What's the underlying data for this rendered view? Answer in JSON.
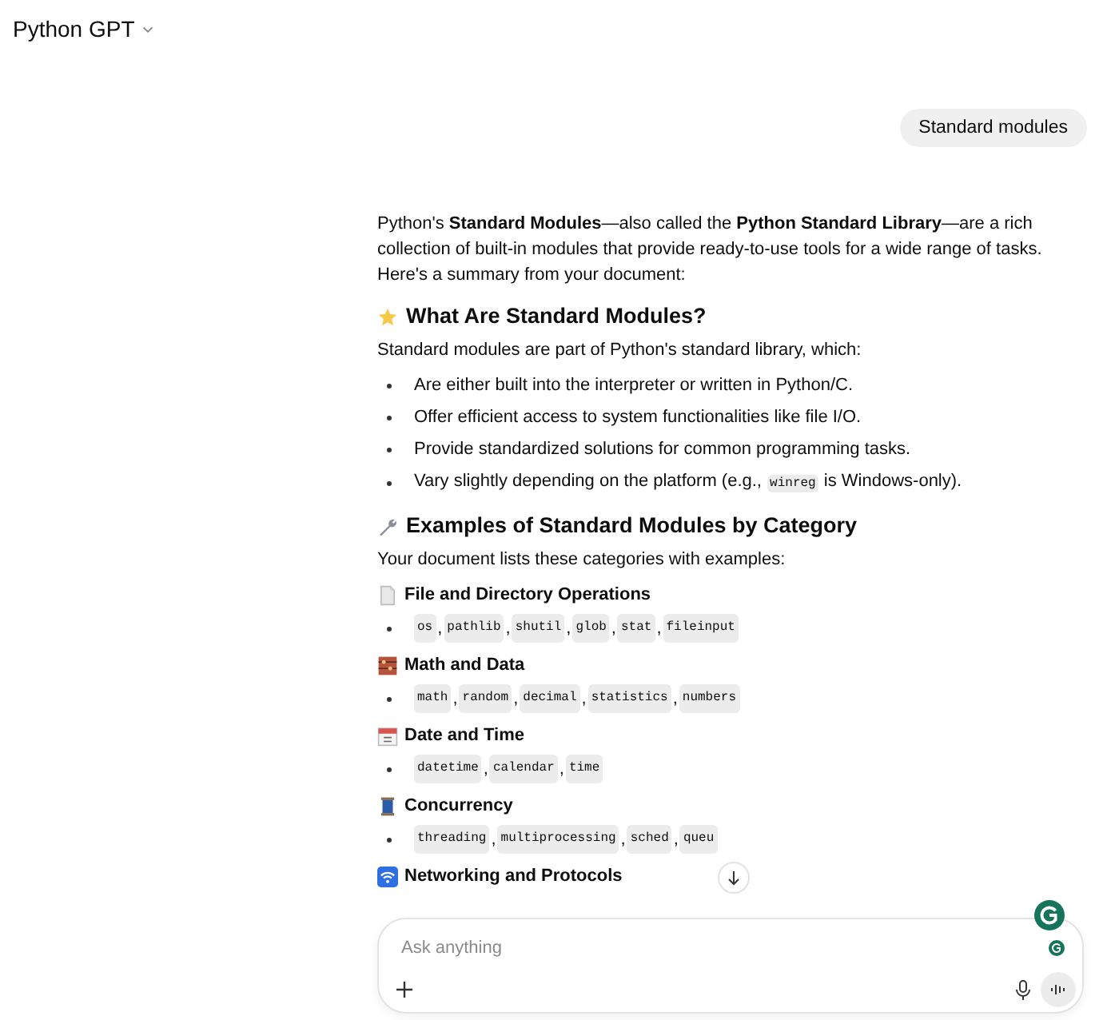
{
  "header": {
    "title": "Python GPT"
  },
  "user_message": "Standard modules",
  "response": [
    {
      "kind": "paragraph",
      "text": "Python's **Standard Modules**—also called the **Python Standard Library**—are a rich collection of built-in modules that provide ready-to-use tools for a wide range of tasks. Here's a summary from your document:"
    },
    {
      "kind": "heading",
      "text": "What Are Standard Modules?"
    },
    {
      "kind": "paragraph",
      "text": "Standard modules are part of Python's standard library, which:"
    },
    {
      "kind": "bullets",
      "items": [
        [
          {
            "text": "Are either built into the interpreter or written in Python/C."
          }
        ],
        [
          {
            "text": "Offer efficient access to system functionalities like file I/O."
          }
        ],
        [
          {
            "text": "Provide standardized solutions for common programming tasks."
          }
        ],
        [
          {
            "text": "Vary slightly depending on the platform (e.g., "
          },
          {
            "code": "winreg"
          },
          {
            "text": " is Windows-only)."
          }
        ]
      ]
    },
    {
      "kind": "heading",
      "text": "Examples of Standard Modules by Category"
    },
    {
      "kind": "paragraph",
      "text": "Your document lists these categories with examples:"
    },
    {
      "kind": "subheading",
      "text": "File and Directory Operations"
    },
    {
      "kind": "codes",
      "separator": ",",
      "items": [
        "os",
        "pathlib",
        "shutil",
        "glob",
        "stat",
        "fileinput"
      ]
    },
    {
      "kind": "subheading",
      "text": "Math and Data"
    },
    {
      "kind": "codes",
      "separator": ",",
      "items": [
        "math",
        "random",
        "decimal",
        "statistics",
        "numbers"
      ]
    },
    {
      "kind": "subheading",
      "text": "Date and Time"
    },
    {
      "kind": "codes",
      "separator": ",",
      "items": [
        "datetime",
        "calendar",
        "time"
      ]
    },
    {
      "kind": "subheading",
      "text": "Concurrency"
    },
    {
      "kind": "codes",
      "separator": ",",
      "items": [
        "threading",
        "multiprocessing",
        "sched",
        "queu"
      ]
    },
    {
      "kind": "subheading",
      "text": "Networking and Protocols"
    }
  ],
  "composer": {
    "placeholder": "Ask anything"
  }
}
